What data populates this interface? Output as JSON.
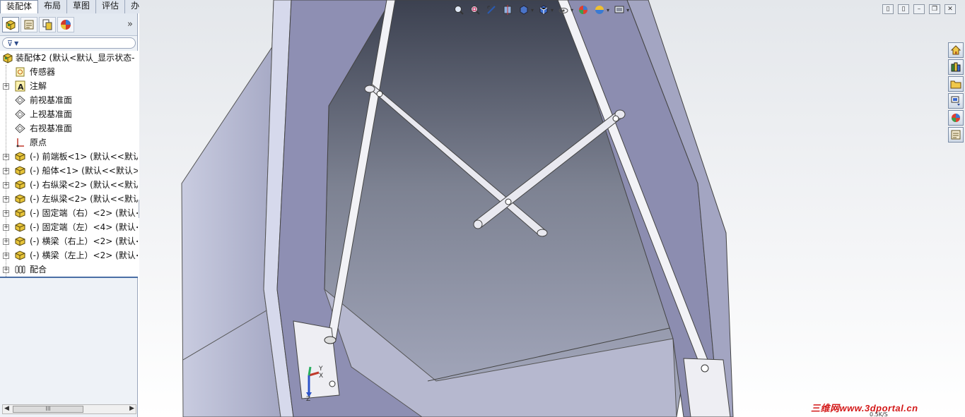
{
  "tabs": [
    {
      "label": "装配体",
      "active": true
    },
    {
      "label": "布局",
      "active": false
    },
    {
      "label": "草图",
      "active": false
    },
    {
      "label": "评估",
      "active": false
    },
    {
      "label": "办公室产品",
      "active": false
    }
  ],
  "panel": {
    "icons": [
      "feature-manager-icon",
      "property-manager-icon",
      "configuration-manager-icon",
      "display-manager-icon"
    ],
    "more_glyph": "»",
    "filter_glyph": "▼"
  },
  "tree": {
    "root": "装配体2  (默认<默认_显示状态-",
    "items": [
      {
        "label": "传感器",
        "icon": "sensor-icon",
        "expandable": false
      },
      {
        "label": "注解",
        "icon": "annotation-icon",
        "expandable": true
      },
      {
        "label": "前视基准面",
        "icon": "plane-icon",
        "expandable": false
      },
      {
        "label": "上视基准面",
        "icon": "plane-icon",
        "expandable": false
      },
      {
        "label": "右视基准面",
        "icon": "plane-icon",
        "expandable": false
      },
      {
        "label": "原点",
        "icon": "origin-icon",
        "expandable": false
      },
      {
        "label": "(-) 前端板<1> (默认<<默认",
        "icon": "part-icon",
        "expandable": true
      },
      {
        "label": "(-) 船体<1> (默认<<默认>_",
        "icon": "part-icon",
        "expandable": true
      },
      {
        "label": "(-) 右纵梁<2> (默认<<默认",
        "icon": "part-icon",
        "expandable": true
      },
      {
        "label": "(-) 左纵梁<2> (默认<<默认",
        "icon": "part-icon",
        "expandable": true
      },
      {
        "label": "(-) 固定端（右）<2> (默认<",
        "icon": "part-icon",
        "expandable": true
      },
      {
        "label": "(-) 固定端（左）<4> (默认<",
        "icon": "part-icon",
        "expandable": true
      },
      {
        "label": "(-) 横梁（右上）<2> (默认<",
        "icon": "part-icon",
        "expandable": true
      },
      {
        "label": "(-) 横梁（左上）<2> (默认<",
        "icon": "part-icon",
        "expandable": true
      },
      {
        "label": "配合",
        "icon": "mates-icon",
        "expandable": true
      }
    ],
    "scroll_thumb": "III"
  },
  "hud_icons": [
    "zoom-to-fit-icon",
    "zoom-area-icon",
    "previous-view-icon",
    "section-view-icon",
    "view-orientation-icon",
    "display-style-icon",
    "hide-show-icon",
    "edit-appearance-icon",
    "apply-scene-icon",
    "view-settings-icon"
  ],
  "window_controls": [
    "tile-left-icon",
    "tile-right-icon",
    "minimize-icon",
    "restore-icon",
    "close-icon"
  ],
  "taskpane": [
    "home-icon",
    "design-library-icon",
    "file-explorer-icon",
    "view-palette-icon",
    "appearances-icon",
    "custom-properties-icon"
  ],
  "triad": {
    "x": "X",
    "y": "Y",
    "z": "Z"
  },
  "watermark": "三维网www.3dportal.cn",
  "speed": "0.5K/S"
}
